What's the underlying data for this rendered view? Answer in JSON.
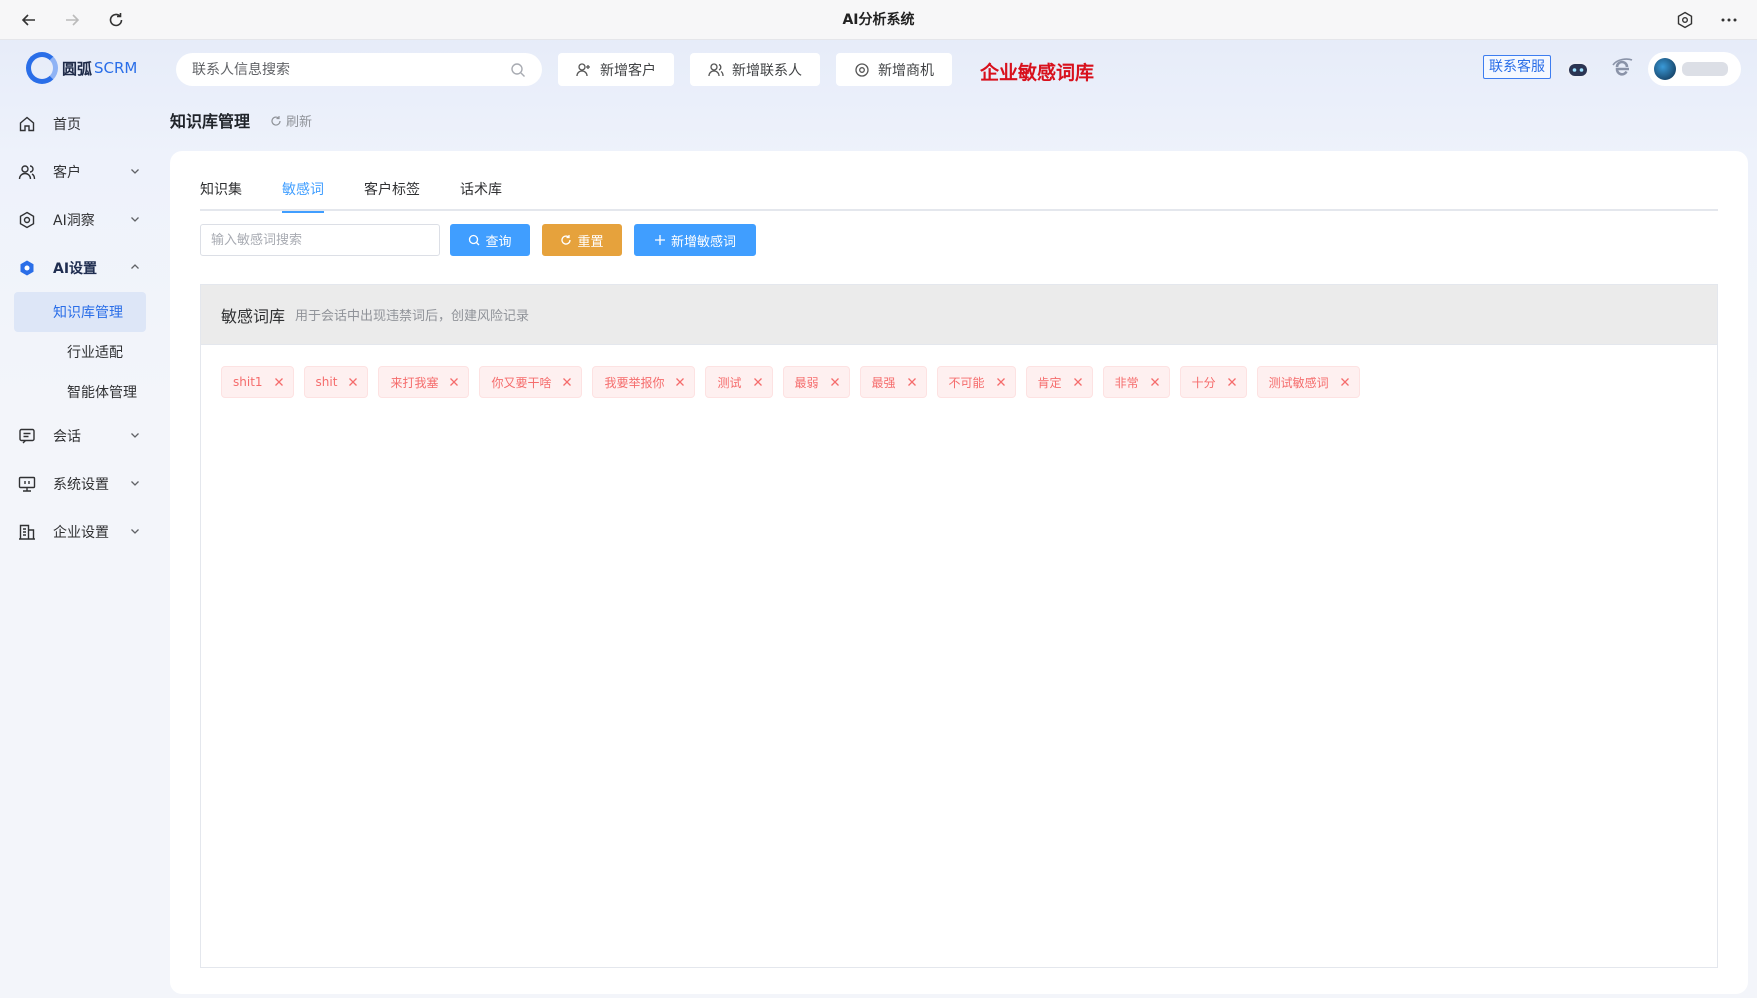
{
  "window": {
    "title": "AI分析系统"
  },
  "header": {
    "logo_cn": "圆弧",
    "logo_en": "SCRM",
    "search_placeholder": "联系人信息搜索",
    "buttons": {
      "add_customer": "新增客户",
      "add_contact": "新增联系人",
      "add_opportunity": "新增商机"
    },
    "banner": "企业敏感词库",
    "customer_service": "联系客服"
  },
  "sidebar": {
    "items": {
      "home": "首页",
      "customer": "客户",
      "ai_insight": "AI洞察",
      "ai_settings": "AI设置",
      "session": "会话",
      "system_settings": "系统设置",
      "enterprise_settings": "企业设置"
    },
    "sub_items": {
      "knowledge": "知识库管理",
      "industry": "行业适配",
      "agent": "智能体管理"
    }
  },
  "page": {
    "title": "知识库管理",
    "refresh": "刷新"
  },
  "tabs": [
    "知识集",
    "敏感词",
    "客户标签",
    "话术库"
  ],
  "toolbar": {
    "input_placeholder": "输入敏感词搜索",
    "query": "查询",
    "reset": "重置",
    "add": "新增敏感词"
  },
  "panel": {
    "title": "敏感词库",
    "desc": "用于会话中出现违禁词后，创建风险记录",
    "tags": [
      "shit1",
      "shit",
      "来打我塞",
      "你又要干啥",
      "我要举报你",
      "测试",
      "最弱",
      "最强",
      "不可能",
      "肯定",
      "非常",
      "十分",
      "测试敏感词"
    ]
  },
  "colors": {
    "primary": "#409eff",
    "warning": "#e6a23c",
    "danger": "#f56c6c",
    "banner": "#d8101c"
  }
}
